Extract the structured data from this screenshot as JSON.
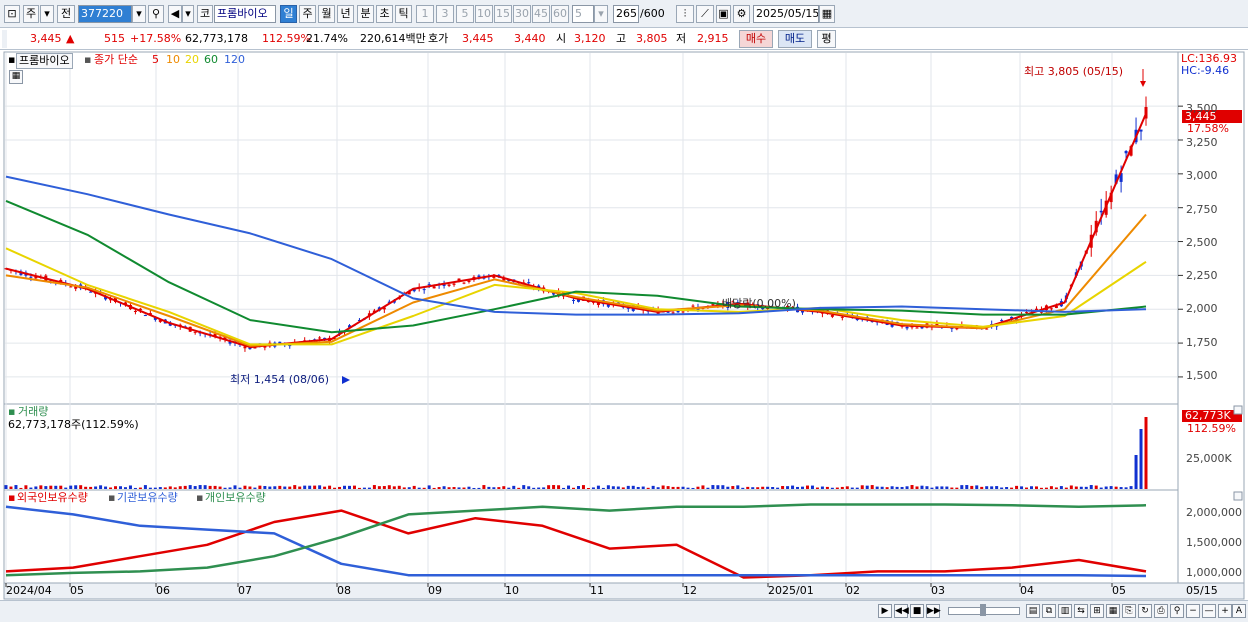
{
  "toolbar": {
    "market": "주",
    "prev_label": "전",
    "code": "377220",
    "market_short": "코",
    "stock_name": "프롬바이오",
    "periods": [
      "일",
      "주",
      "월",
      "년",
      "분",
      "초",
      "틱"
    ],
    "selected_period": "일",
    "intervals": [
      "1",
      "3",
      "5",
      "10",
      "15",
      "30",
      "45",
      "60"
    ],
    "interval_value": "5",
    "count": "265",
    "count_max": "/600",
    "date": "2025/05/15"
  },
  "quote": {
    "price": "3,445",
    "change_arrow": "▲",
    "change": "515",
    "change_pct": "+17.58%",
    "volume": "62,773,178",
    "volume_ratio": "112.59%",
    "turnover": "21.74%",
    "trade_value": "220,614백만",
    "hoga_label": "호가",
    "ask": "3,445",
    "bid": "3,440",
    "open_label": "시",
    "open": "3,120",
    "high_label": "고",
    "high": "3,805",
    "low_label": "저",
    "low": "2,915",
    "buy_label": "매수",
    "sell_label": "매도",
    "avg_label": "평"
  },
  "price_panel": {
    "stock": "프롬바이오",
    "ma_label": "종가 단순",
    "ma_periods": [
      {
        "label": "5",
        "color": "#e00000"
      },
      {
        "label": "10",
        "color": "#ee8a00"
      },
      {
        "label": "20",
        "color": "#e8d400"
      },
      {
        "label": "60",
        "color": "#108a30"
      },
      {
        "label": "120",
        "color": "#2f5fd8"
      }
    ],
    "lc": "LC:136.93",
    "hc": "HC:-9.46",
    "high_annot": "최고 3,805 (05/15)",
    "low_annot": "최저 1,454 (08/06)",
    "dividend_annot": "배당락(0.00%)",
    "current_price_tag": "3,445",
    "current_pct_tag": "17.58%",
    "y_ticks": [
      "3,500",
      "3,250",
      "3,000",
      "2,750",
      "2,500",
      "2,250",
      "2,000",
      "1,750",
      "1,500"
    ]
  },
  "volume_panel": {
    "title": "거래량",
    "value_text": "62,773,178주(112.59%)",
    "tag_value": "62,773K",
    "tag_pct": "112.59%",
    "y_tick": "25,000K"
  },
  "holding_panel": {
    "series": [
      {
        "name": "외국인보유수량",
        "color": "#e00000"
      },
      {
        "name": "기관보유수량",
        "color": "#2f5fd8"
      },
      {
        "name": "개인보유수량",
        "color": "#2f8f50"
      }
    ],
    "y_ticks": [
      "2,000,000",
      "1,500,000",
      "1,000,000"
    ]
  },
  "x_axis": {
    "labels": [
      "2024/04",
      "05",
      "06",
      "07",
      "08",
      "09",
      "10",
      "11",
      "12",
      "2025/01",
      "02",
      "03",
      "04",
      "05"
    ],
    "last_date": "05/15"
  },
  "colors": {
    "up": "#e00000",
    "down": "#1030d0",
    "ma5": "#e00000",
    "ma10": "#ee8a00",
    "ma20": "#e8d400",
    "ma60": "#108a30",
    "ma120": "#2f5fd8"
  },
  "chart_data": {
    "type": "line",
    "title": "",
    "xlabel": "",
    "ylabel": "",
    "ylim": [
      1300,
      3900
    ],
    "x": [
      "2024/04",
      "05",
      "06",
      "07",
      "08",
      "09",
      "10",
      "11",
      "12",
      "2025/01",
      "02",
      "03",
      "04",
      "05",
      "05/15"
    ],
    "series": [
      {
        "name": "5",
        "values": [
          2300,
          2150,
          1900,
          1720,
          1780,
          2150,
          2250,
          2080,
          1980,
          2040,
          1980,
          1880,
          1860,
          2050,
          3445
        ]
      },
      {
        "name": "10",
        "values": [
          2250,
          2160,
          1950,
          1730,
          1760,
          2050,
          2220,
          2090,
          1990,
          2030,
          1990,
          1890,
          1860,
          2000,
          2700
        ]
      },
      {
        "name": "20",
        "values": [
          2450,
          2180,
          1980,
          1740,
          1740,
          1950,
          2180,
          2120,
          2000,
          1980,
          2010,
          1920,
          1870,
          1950,
          2350
        ]
      },
      {
        "name": "60",
        "values": [
          2800,
          2550,
          2200,
          1920,
          1830,
          1880,
          2000,
          2130,
          2100,
          2020,
          2000,
          1990,
          1960,
          1960,
          2020
        ]
      },
      {
        "name": "120",
        "values": [
          2980,
          2850,
          2700,
          2560,
          2370,
          2080,
          1980,
          1960,
          1960,
          1970,
          2010,
          2020,
          2000,
          1980,
          2000
        ]
      }
    ]
  }
}
